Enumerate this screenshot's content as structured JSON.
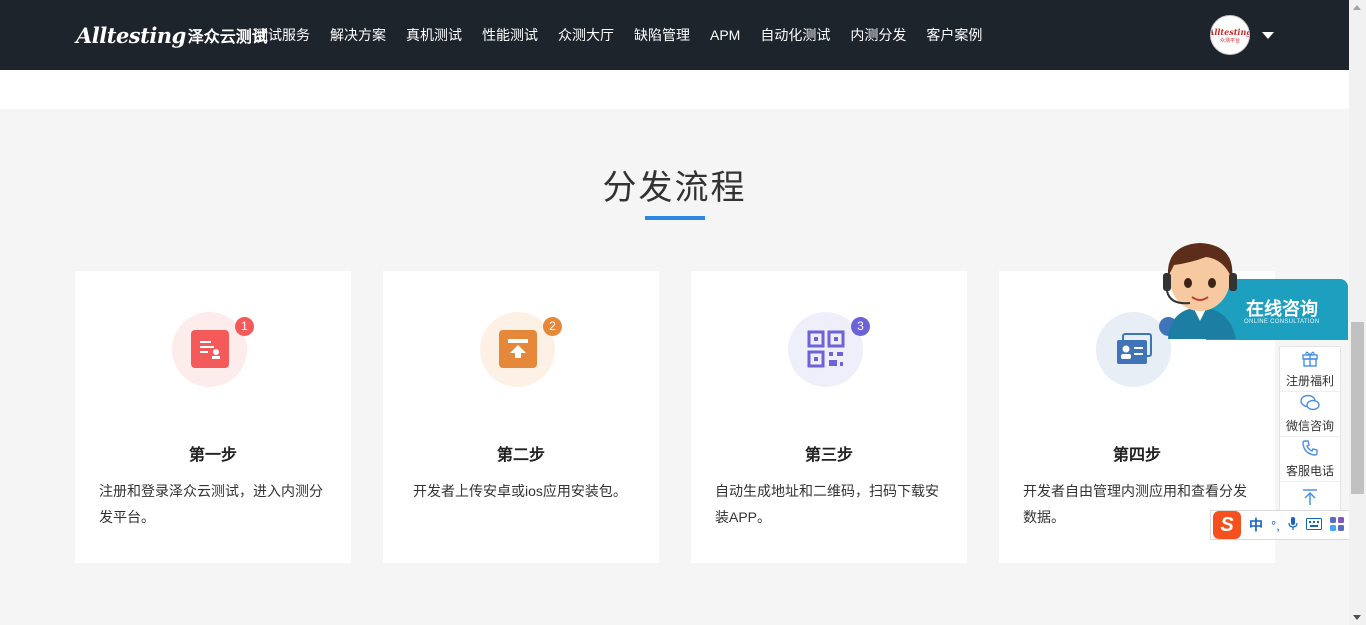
{
  "header": {
    "logo_en": "Alltesting",
    "logo_cn": "泽众云测试",
    "nav": [
      "测试服务",
      "解决方案",
      "真机测试",
      "性能测试",
      "众测大厅",
      "缺陷管理",
      "APM",
      "自动化测试",
      "内测分发",
      "客户案例"
    ],
    "avatar_text": "Alltesting",
    "avatar_sub": "众测平台"
  },
  "section": {
    "title": "分发流程"
  },
  "steps": [
    {
      "num": "1",
      "title": "第一步",
      "desc": "注册和登录泽众云测试，进入内测分发平台。",
      "icon": "certificate-icon",
      "color": "#f55a5a",
      "bg": "#fdecec"
    },
    {
      "num": "2",
      "title": "第二步",
      "desc": "开发者上传安卓或ios应用安装包。",
      "icon": "upload-box-icon",
      "color": "#e5883a",
      "bg": "#fdf1e6"
    },
    {
      "num": "3",
      "title": "第三步",
      "desc": "自动生成地址和二维码，扫码下载安装APP。",
      "icon": "qrcode-icon",
      "color": "#6c63d6",
      "bg": "#efeefb"
    },
    {
      "num": "",
      "title": "第四步",
      "desc": "开发者自由管理内测应用和查看分发数据。",
      "icon": "id-card-icon",
      "color": "#3f74b8",
      "bg": "#e8eef6"
    }
  ],
  "consult": {
    "title": "在线咨询",
    "subtitle": "ONLINE CONSULTATION"
  },
  "sidebar": {
    "items": [
      {
        "label": "注册福利",
        "icon": "gift-icon"
      },
      {
        "label": "微信咨询",
        "icon": "wechat-icon"
      },
      {
        "label": "客服电话",
        "icon": "phone-icon"
      }
    ],
    "top_icon": "back-to-top-icon"
  },
  "ime": {
    "logo": "S",
    "mode": "中",
    "punct": "°,"
  }
}
